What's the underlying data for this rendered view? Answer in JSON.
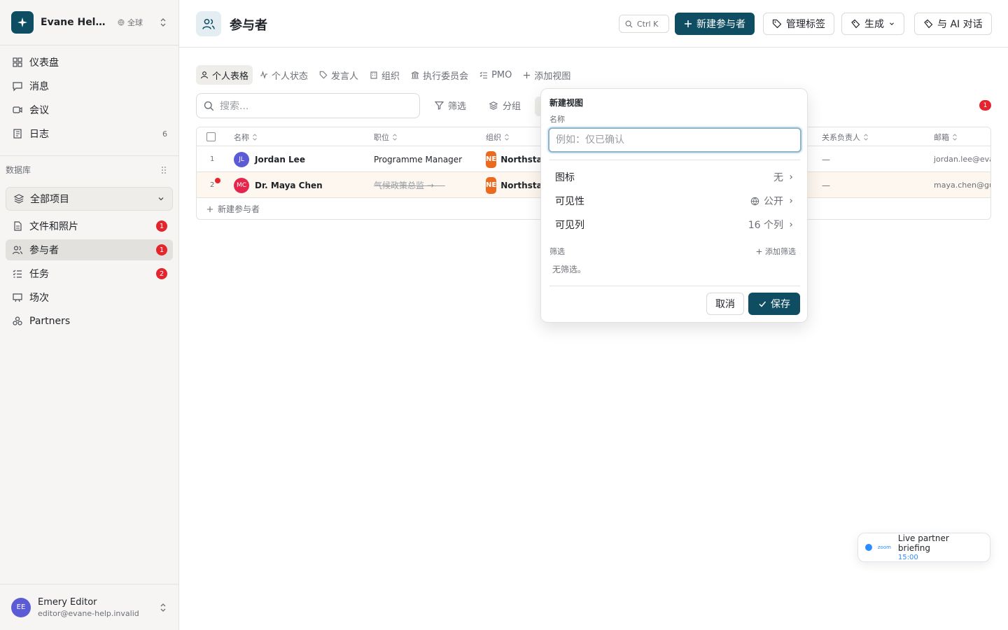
{
  "workspace": {
    "name": "Evane Help Center",
    "scope": "全球"
  },
  "nav": {
    "items": [
      {
        "label": "仪表盘",
        "icon": "dashboard-icon"
      },
      {
        "label": "消息",
        "icon": "message-icon"
      },
      {
        "label": "会议",
        "icon": "video-icon"
      },
      {
        "label": "日志",
        "icon": "journal-icon",
        "count": "6"
      }
    ]
  },
  "database": {
    "section_label": "数据库",
    "selector": "全部项目",
    "items": [
      {
        "label": "文件和照片",
        "icon": "file-icon",
        "badge": "1"
      },
      {
        "label": "参与者",
        "icon": "users-icon",
        "badge": "1",
        "active": true
      },
      {
        "label": "任务",
        "icon": "tasks-icon",
        "badge": "2"
      },
      {
        "label": "场次",
        "icon": "presentation-icon"
      },
      {
        "label": "Partners",
        "icon": "partners-icon"
      }
    ]
  },
  "user": {
    "initials": "EE",
    "name": "Emery Editor",
    "email": "editor@evane-help.invalid"
  },
  "header": {
    "title": "参与者",
    "shortcut": "Ctrl K",
    "new_button": "新建参与者",
    "manage_tags": "管理标签",
    "generate": "生成",
    "ai_chat": "与 AI 对话"
  },
  "views": {
    "tabs": [
      "个人表格",
      "个人状态",
      "发言人",
      "组织",
      "执行委员会",
      "PMO"
    ],
    "add_view": "添加视图"
  },
  "toolbar": {
    "search_placeholder": "搜索...",
    "filter": "筛选",
    "group": "分组",
    "alert_count": "1"
  },
  "table": {
    "columns": [
      "名称",
      "职位",
      "组织",
      "关系负责人",
      "邮箱"
    ],
    "rows": [
      {
        "num": "1",
        "initials": "JL",
        "name": "Jordan Lee",
        "avatar_color": "#5b5bd6",
        "title": "Programme Manager",
        "title_struck": false,
        "org_initials": "NE",
        "org": "Northstar",
        "owner": "—",
        "email": "jordan.lee@evane"
      },
      {
        "num": "2",
        "initials": "MC",
        "name": "Dr. Maya Chen",
        "avatar_color": "#e5254b",
        "title": "气候政策总监 → —",
        "title_struck": true,
        "org_initials": "NE",
        "org": "Northstar",
        "owner": "—",
        "email": "maya.chen@gu"
      }
    ],
    "add_row": "新建参与者"
  },
  "popover": {
    "title": "新建视图",
    "name_label": "名称",
    "name_placeholder": "例如：仅已确认",
    "name_value": "",
    "icon_label": "图标",
    "icon_value": "无",
    "visibility_label": "可见性",
    "visibility_value": "公开",
    "columns_label": "可见列",
    "columns_value": "16 个列",
    "filter_label": "筛选",
    "add_filter": "添加筛选",
    "no_filter": "无筛选。",
    "cancel": "取消",
    "save": "保存"
  },
  "meeting": {
    "provider": "zoom",
    "title": "Live partner briefing",
    "time": "15:00"
  },
  "colors": {
    "primary": "#0f4d63",
    "badge": "#e5252d",
    "org": "#ea6b1f",
    "zoom": "#2d8cff"
  }
}
